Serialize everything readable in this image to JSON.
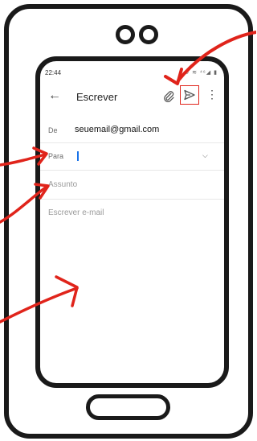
{
  "status_bar": {
    "time": "22:44",
    "icons": "⊛ ≋ ⁴⁶◢ ▮"
  },
  "app_bar": {
    "back_icon": "back-arrow-icon",
    "title": "Escrever",
    "attach_icon": "paperclip-icon",
    "send_icon": "send-icon",
    "more_icon": "more-vert-icon"
  },
  "compose": {
    "from_label": "De",
    "from_value": "seuemail@gmail.com",
    "to_label": "Para",
    "to_value": "",
    "subject_placeholder": "Assunto",
    "body_placeholder": "Escrever e-mail"
  },
  "colors": {
    "annotation_red": "#e0241b",
    "cursor_blue": "#1a73e8",
    "frame_black": "#1a1a1a"
  }
}
